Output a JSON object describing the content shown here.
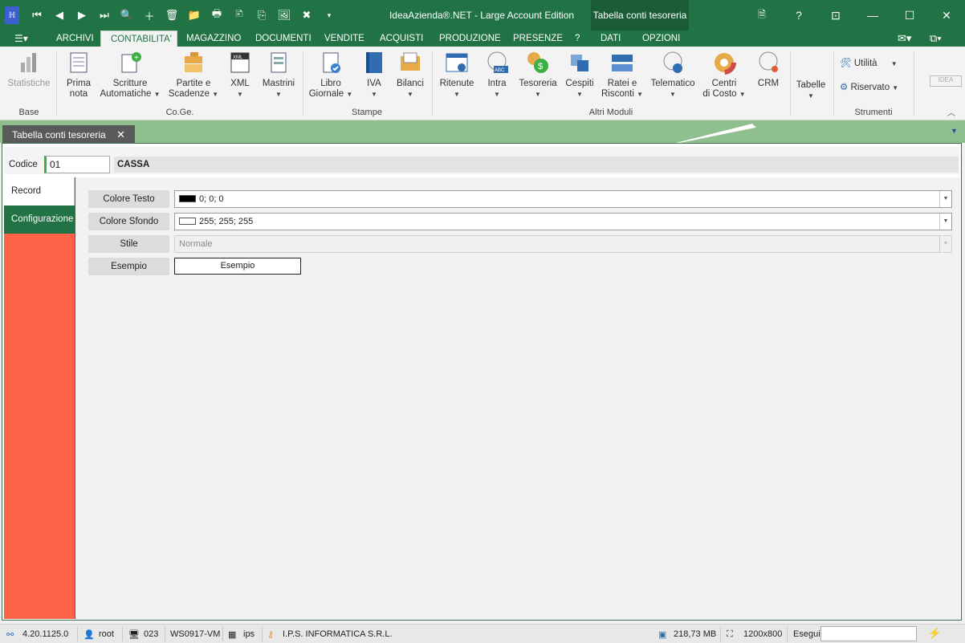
{
  "window": {
    "app_title": "IdeaAzienda®.NET - Large Account Edition",
    "context_title": "Tabella conti tesoreria",
    "minimize": "—",
    "maximize": "☐",
    "close": "✕",
    "help": "?",
    "restore": "⊡",
    "doc": "🗎"
  },
  "qat": [
    "⏮",
    "◀",
    "▶",
    "⏭",
    "🔍",
    "＋",
    "🗑",
    "📁",
    "🖶",
    "🗈",
    "⎘",
    "🖼",
    "✖",
    "▾"
  ],
  "tabs": {
    "archivi": "ARCHIVI",
    "contabilita": "CONTABILITA'",
    "magazzino": "MAGAZZINO",
    "documenti": "DOCUMENTI",
    "vendite": "VENDITE",
    "acquisti": "ACQUISTI",
    "produzione": "PRODUZIONE",
    "presenze": "PRESENZE",
    "help": "?",
    "dati": "DATI",
    "opzioni": "OPZIONI"
  },
  "ribbon": {
    "statistiche": "Statistiche",
    "prima_nota_1": "Prima",
    "prima_nota_2": "nota",
    "scritture_1": "Scritture",
    "scritture_2": "Automatiche",
    "partite_1": "Partite e",
    "partite_2": "Scadenze",
    "xml": "XML",
    "mastrini": "Mastrini",
    "libro_1": "Libro",
    "libro_2": "Giornale",
    "iva": "IVA",
    "bilanci": "Bilanci",
    "ritenute": "Ritenute",
    "intra": "Intra",
    "tesoreria": "Tesoreria",
    "cespiti": "Cespiti",
    "ratei_1": "Ratei e",
    "ratei_2": "Risconti",
    "telematico": "Telematico",
    "centri_1": "Centri",
    "centri_2": "di Costo",
    "crm": "CRM",
    "tabelle": "Tabelle",
    "utilita": "Utilità",
    "riservato": "Riservato",
    "groups": {
      "base": "Base",
      "coge": "Co.Ge.",
      "stampe": "Stampe",
      "altri": "Altri Moduli",
      "strumenti": "Strumenti"
    }
  },
  "doc_tab": {
    "label": "Tabella conti tesoreria",
    "close": "✕"
  },
  "form": {
    "codice_label": "Codice",
    "codice_value": "01",
    "descrizione": "CASSA",
    "side_tabs": [
      "Record",
      "Configurazione"
    ],
    "fields": {
      "colore_testo_label": "Colore Testo",
      "colore_testo_value": "0; 0; 0",
      "colore_testo_swatch": "#000000",
      "colore_sfondo_label": "Colore Sfondo",
      "colore_sfondo_value": "255; 255; 255",
      "colore_sfondo_swatch": "#ffffff",
      "stile_label": "Stile",
      "stile_value": "Normale",
      "esempio_label": "Esempio",
      "esempio_value": "Esempio"
    }
  },
  "status": {
    "version": "4.20.1125.0",
    "user": "root",
    "station": "023",
    "machine": "WS0917-VM",
    "company_code": "ips",
    "company_name": "I.P.S. INFORMATICA S.R.L.",
    "memory": "218,73 MB",
    "resolution": "1200x800",
    "esegui_label": "Esegui",
    "esegui_value": ""
  },
  "colors": {
    "accent": "#217346",
    "side_panel": "#ff6347",
    "doc_strip": "#8fbf8f"
  }
}
